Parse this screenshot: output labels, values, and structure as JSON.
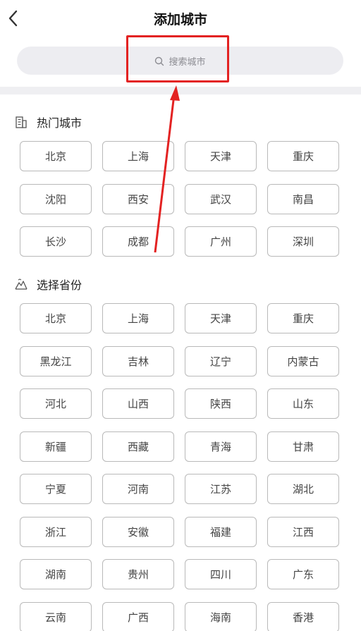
{
  "header": {
    "title": "添加城市",
    "back_icon": "chevron-left-icon"
  },
  "search": {
    "placeholder": "搜索城市",
    "icon": "search-icon"
  },
  "hot_section": {
    "title": "热门城市",
    "icon": "building-icon",
    "cities": [
      "北京",
      "上海",
      "天津",
      "重庆",
      "沈阳",
      "西安",
      "武汉",
      "南昌",
      "长沙",
      "成都",
      "广州",
      "深圳"
    ]
  },
  "province_section": {
    "title": "选择省份",
    "icon": "mountain-icon",
    "provinces": [
      "北京",
      "上海",
      "天津",
      "重庆",
      "黑龙江",
      "吉林",
      "辽宁",
      "内蒙古",
      "河北",
      "山西",
      "陕西",
      "山东",
      "新疆",
      "西藏",
      "青海",
      "甘肃",
      "宁夏",
      "河南",
      "江苏",
      "湖北",
      "浙江",
      "安徽",
      "福建",
      "江西",
      "湖南",
      "贵州",
      "四川",
      "广东",
      "云南",
      "广西",
      "海南",
      "香港"
    ]
  },
  "colors": {
    "annotation": "#e32222",
    "search_bg": "#ededf1",
    "chip_border": "#b9b9b9"
  }
}
